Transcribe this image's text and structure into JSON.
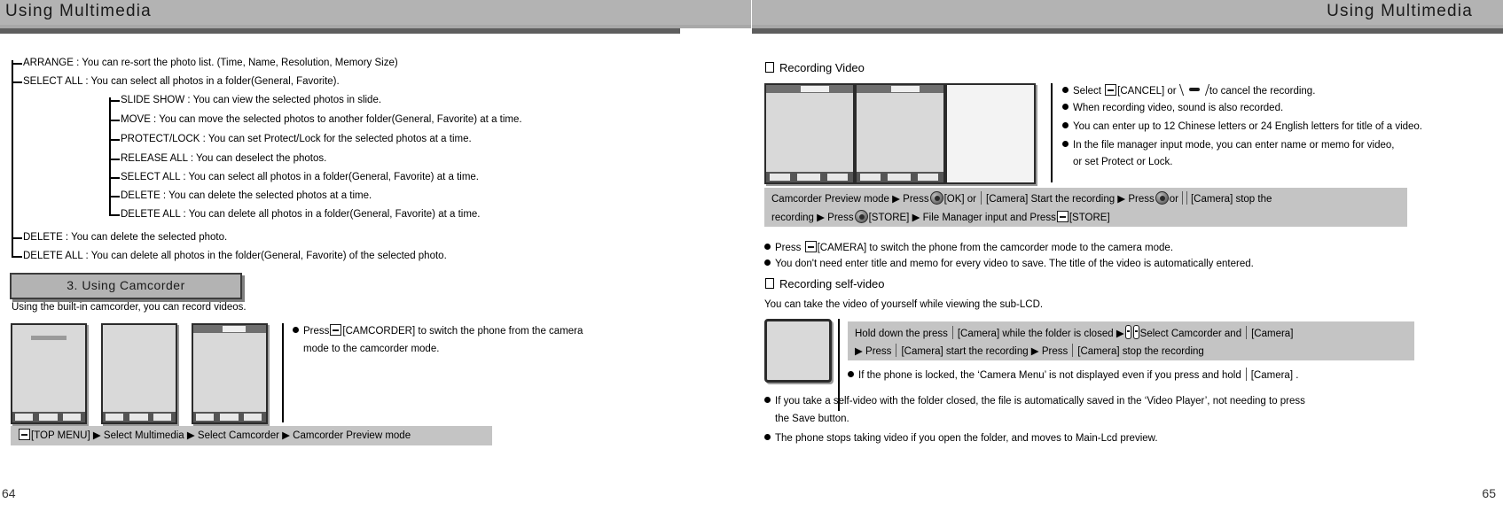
{
  "header": {
    "left_title": "Using Multimedia",
    "right_title": "Using Multimedia"
  },
  "left_page": {
    "page_number": "64",
    "tree": {
      "top_items": [
        "ARRANGE : You can re-sort the photo list. (Time, Name, Resolution, Memory Size)",
        "SELECT ALL : You can select all photos in a folder(General, Favorite)."
      ],
      "sub_items": [
        "SLIDE SHOW : You can view the selected photos in slide.",
        "MOVE : You can move the selected photos to another folder(General, Favorite) at a time.",
        "PROTECT/LOCK : You can set Protect/Lock for the selected photos at a time.",
        "RELEASE ALL : You can deselect the photos.",
        "SELECT ALL : You can select all photos in a folder(General, Favorite) at a time.",
        "DELETE : You can delete the selected photos at a time.",
        "DELETE ALL : You can delete all photos in a folder(General, Favorite) at a time."
      ],
      "bottom_items": [
        "DELETE : You can delete the selected photo.",
        "DELETE ALL : You can delete all photos in the folder(General, Favorite) of the selected photo."
      ]
    },
    "section_heading": "3. Using Camcorder",
    "section_intro": "Using the built-in camcorder, you can record videos.",
    "bullets": [
      {
        "pre": "Press",
        "key": "soft-key-icon",
        "post": "[CAMCORDER] to switch the phone from the camera",
        "cont": "mode to the camcorder mode."
      }
    ],
    "command_strip": {
      "key": "soft-key-icon",
      "text": "[TOP MENU] ▶ Select Multimedia ▶ Select Camcorder ▶ Camcorder Preview mode"
    },
    "thumbnails": [
      "camcorder-menu-grid",
      "camcorder-menu-list",
      "camcorder-preview-photo"
    ]
  },
  "right_page": {
    "page_number": "65",
    "section_recording_video": {
      "heading": "Recording Video",
      "thumbnails": [
        "video-recording-1",
        "video-recording-2",
        "video-file-manager"
      ],
      "bullets": [
        {
          "pre": "Select",
          "key": "soft-key-icon",
          "mid": "[CANCEL] or",
          "key2": "end-key-icon",
          "post": "to cancel the recording."
        },
        {
          "text": "When recording video, sound is also recorded."
        },
        {
          "text": "You can enter up to 12 Chinese letters or 24 English letters for title of a video."
        },
        {
          "text": "In the file manager input mode, you can enter name or memo for video,"
        },
        {
          "text": "or set Protect or Lock.",
          "indent": true
        }
      ],
      "command_strip": {
        "line1_a": "Camcorder Preview mode ▶ Press",
        "line1_key1": "ok-key-icon",
        "line1_b": "[OK] or",
        "line1_c": "[Camera] Start the recording ▶ Press",
        "line1_key2": "ok-key-icon",
        "line1_d": "or",
        "line1_e": "[Camera] stop the",
        "line2_a": "recording ▶ Press",
        "line2_key1": "ok-key-icon",
        "line2_b": "[STORE] ▶ File Manager input and Press",
        "line2_key2": "soft-key-icon",
        "line2_c": "[STORE]"
      },
      "post_bullets": [
        {
          "pre": "Press",
          "key": "soft-key-icon",
          "post": "[CAMERA] to switch the phone from the camcorder mode to the camera mode."
        },
        {
          "text": "You don't need enter title and memo for every video to save. The title of the video is automatically entered."
        }
      ]
    },
    "section_self_video": {
      "heading": "Recording self-video",
      "intro": "You can take the video of yourself while viewing the sub-LCD.",
      "thumbnail": "sub-lcd-preview",
      "command_strip": {
        "line1_a": "Hold down the press",
        "line1_b": "[Camera] while the folder is closed ▶",
        "line1_c": "Select Camcorder and",
        "line1_d": "[Camera]",
        "line2_a": "▶ Press",
        "line2_b": "[Camera] start the recording ▶ Press",
        "line2_c": "[Camera] stop the recording"
      },
      "inner_bullet": {
        "a": "If the phone is locked, the ",
        "b": "‘Camera Menu’",
        "c": " is not displayed even if you press and hold",
        "d": "[Camera] ."
      },
      "bullets": [
        {
          "text": "If you take a self-video with the folder closed, the file is automatically saved in the ‘Video Player’, not needing to press"
        },
        {
          "text": "the Save button.",
          "indent": true
        },
        {
          "text": "The phone stops taking video if you open the folder, and moves to Main-Lcd preview."
        }
      ]
    }
  }
}
